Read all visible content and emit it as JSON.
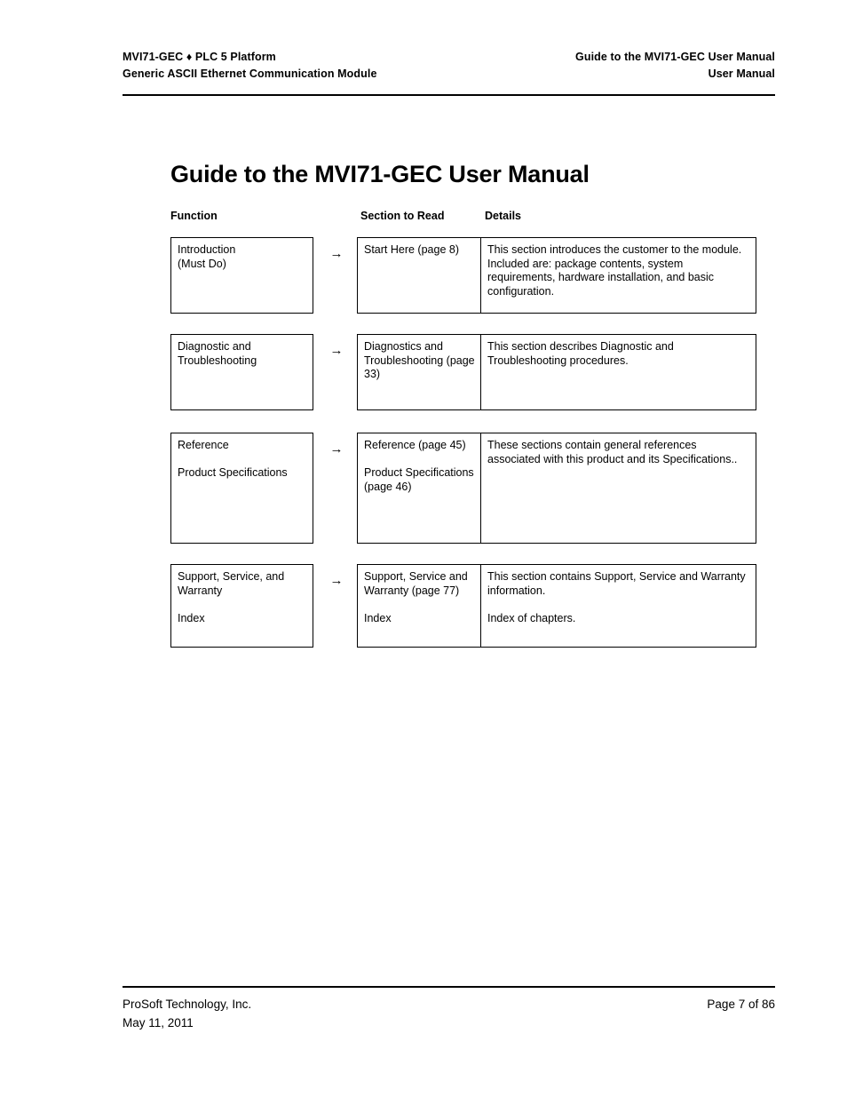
{
  "header": {
    "left_line1": "MVI71-GEC ♦ PLC 5 Platform",
    "left_line2": "Generic ASCII Ethernet Communication Module",
    "right_line1": "Guide to the MVI71-GEC User Manual",
    "right_line2": "User Manual"
  },
  "title": "Guide to the MVI71-GEC User Manual",
  "columns": {
    "function": "Function",
    "section": "Section to Read",
    "details": "Details"
  },
  "arrow_glyph": "→",
  "rows": [
    {
      "function_line1": "Introduction",
      "function_line2": "(Must Do)",
      "section_line1": "Start Here (page 8)",
      "section_line2": "",
      "details_line1": "This section introduces the customer to the module. Included are: package contents, system requirements, hardware installation, and basic configuration.",
      "details_line2": ""
    },
    {
      "function_line1": "Diagnostic and Troubleshooting",
      "function_line2": "",
      "section_line1": "Diagnostics and Troubleshooting (page 33)",
      "section_line2": "",
      "details_line1": "This section describes Diagnostic and Troubleshooting procedures.",
      "details_line2": ""
    },
    {
      "function_line1": "Reference",
      "function_line2": "Product Specifications",
      "section_line1": "Reference (page 45)",
      "section_line2": "Product Specifications (page 46)",
      "details_line1": "These sections contain general references associated with this product and its Specifications..",
      "details_line2": ""
    },
    {
      "function_line1": "Support, Service, and Warranty",
      "function_line2": "Index",
      "section_line1": "Support, Service and Warranty (page 77)",
      "section_line2": "Index",
      "details_line1": "This section contains Support, Service and Warranty information.",
      "details_line2": "Index of chapters."
    }
  ],
  "footer": {
    "left_line1": "ProSoft Technology, Inc.",
    "left_line2": "May 11, 2011",
    "right_line1": "Page 7 of 86"
  }
}
